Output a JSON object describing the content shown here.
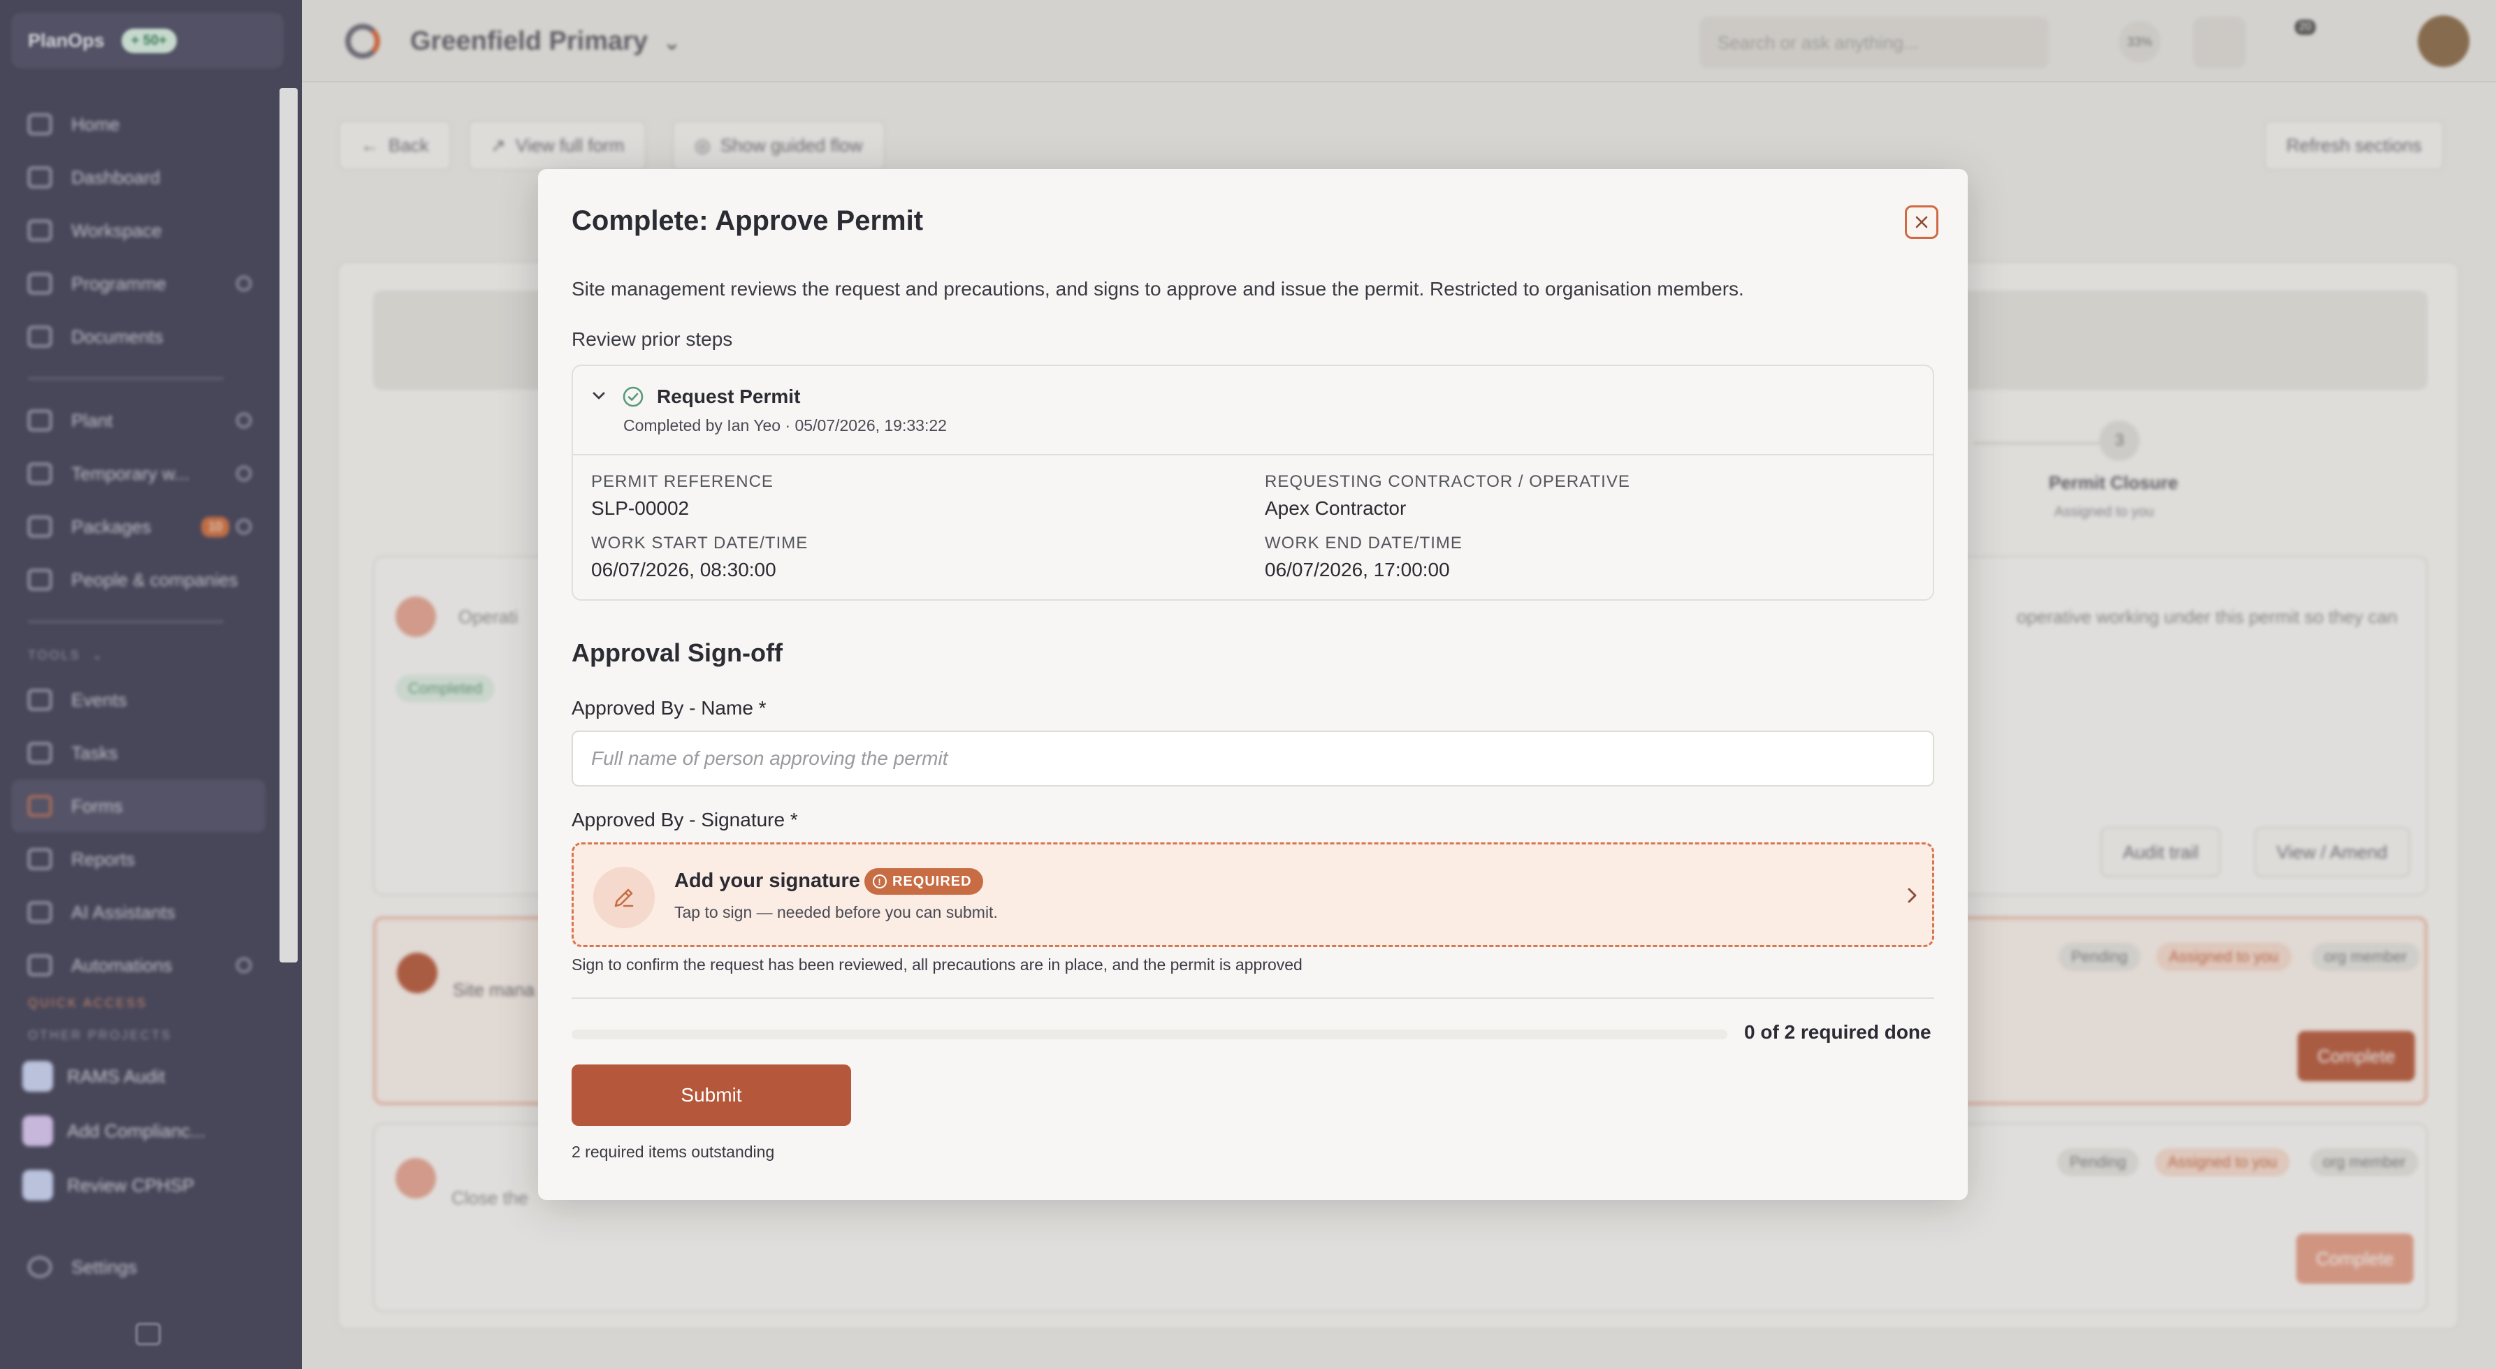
{
  "sidebar": {
    "brand": "PlanOps",
    "brand_badge": "+ 50+",
    "items": [
      {
        "label": "Home"
      },
      {
        "label": "Dashboard"
      },
      {
        "label": "Workspace"
      },
      {
        "label": "Programme"
      },
      {
        "label": "Documents"
      }
    ],
    "items2": [
      {
        "label": "Plant"
      },
      {
        "label": "Temporary w..."
      },
      {
        "label": "Packages",
        "count": "10"
      },
      {
        "label": "People & companies"
      }
    ],
    "tools_label": "TOOLS",
    "tools": [
      {
        "label": "Events"
      },
      {
        "label": "Tasks"
      },
      {
        "label": "Forms"
      },
      {
        "label": "Reports"
      },
      {
        "label": "AI Assistants"
      },
      {
        "label": "Automations"
      }
    ],
    "quick_access_label": "QUICK ACCESS",
    "other_projects_label": "OTHER PROJECTS",
    "projects": [
      {
        "label": "RAMS Audit"
      },
      {
        "label": "Add Complianc..."
      },
      {
        "label": "Review CPHSP"
      }
    ],
    "settings_label": "Settings"
  },
  "topbar": {
    "project": "Greenfield Primary",
    "search_placeholder": "Search or ask anything...",
    "zoom": "33%",
    "notifications": "20"
  },
  "main": {
    "back_label": "Back",
    "view_full_form_label": "View full form",
    "guided_flow_label": "Show guided flow",
    "refresh_label": "Refresh sections",
    "step3_num": "3",
    "step3_title": "Permit Closure",
    "step3_sub": "Assigned to you",
    "step1_text": "Operati",
    "step1_text_right": "operative working under this permit so they can",
    "step1_status": "Completed",
    "audit_label": "Audit trail",
    "amend_label": "View / Amend",
    "step2_text": "Site mana",
    "step3_text": "Close the",
    "pending_label": "Pending",
    "assigned_label": "Assigned to you",
    "org_label": "org member",
    "complete_label": "Complete"
  },
  "modal": {
    "title": "Complete: Approve Permit",
    "description": "Site management reviews the request and precautions, and signs to approve and issue the permit. Restricted to organisation members.",
    "review_label": "Review prior steps",
    "prior_step": {
      "name": "Request Permit",
      "completed_by": "Completed by Ian Yeo · 05/07/2026, 19:33:22",
      "fields": [
        {
          "label": "Permit reference",
          "value": "SLP-00002"
        },
        {
          "label": "Requesting contractor / operative",
          "value": "Apex Contractor"
        },
        {
          "label": "Work start date/time",
          "value": "06/07/2026, 08:30:00"
        },
        {
          "label": "Work end date/time",
          "value": "06/07/2026, 17:00:00"
        }
      ]
    },
    "section_title": "Approval Sign-off",
    "name_label": "Approved By - Name *",
    "name_placeholder": "Full name of person approving the permit",
    "name_value": "",
    "signature_label": "Approved By - Signature *",
    "signature_title": "Add your signature",
    "required_badge": "REQUIRED",
    "signature_sub": "Tap to sign — needed before you can submit.",
    "signature_help": "Sign to confirm the request has been reviewed, all precautions are in place, and the permit is approved",
    "progress_done": 0,
    "progress_total": 2,
    "progress_text": "0 of 2 required done",
    "submit_label": "Submit",
    "outstanding_text": "2 required items outstanding"
  },
  "colors": {
    "accent": "#b5573a",
    "sidebar_bg": "#3d3d55",
    "signature_border": "#d9764f"
  }
}
